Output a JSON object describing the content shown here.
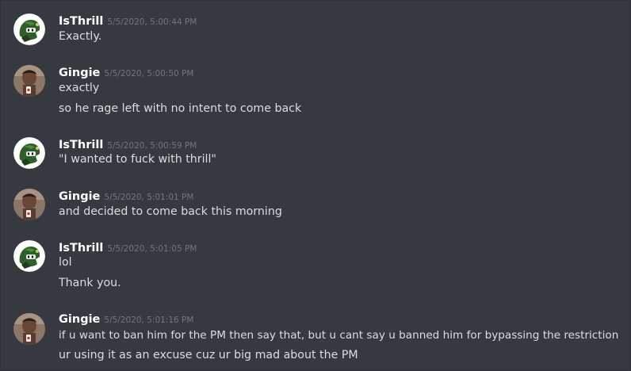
{
  "messages": [
    {
      "author": "IsThrill",
      "avatar_icon": "green-mask-icon",
      "timestamp": "5/5/2020, 5:00:44 PM",
      "lines": [
        "Exactly."
      ]
    },
    {
      "author": "Gingie",
      "avatar_icon": "photo-avatar-icon",
      "timestamp": "5/5/2020, 5:00:50 PM",
      "lines": [
        "exactly",
        "so he rage left with no intent to come back"
      ]
    },
    {
      "author": "IsThrill",
      "avatar_icon": "green-mask-icon",
      "timestamp": "5/5/2020, 5:00:59 PM",
      "lines": [
        "\"I wanted to fuck with thrill\""
      ]
    },
    {
      "author": "Gingie",
      "avatar_icon": "photo-avatar-icon",
      "timestamp": "5/5/2020, 5:01:01 PM",
      "lines": [
        "and decided to come back this morning"
      ]
    },
    {
      "author": "IsThrill",
      "avatar_icon": "green-mask-icon",
      "timestamp": "5/5/2020, 5:01:05 PM",
      "lines": [
        "lol",
        "Thank you."
      ]
    },
    {
      "author": "Gingie",
      "avatar_icon": "photo-avatar-icon",
      "timestamp": "5/5/2020, 5:01:16 PM",
      "lines": [
        "if u want to ban him for the PM then say that, but u cant say u banned him for bypassing the restriction",
        "ur using it as an excuse cuz ur big mad about the PM"
      ]
    }
  ],
  "colors": {
    "background": "#36393f",
    "username": "#ffffff",
    "timestamp": "#72767d",
    "message_text": "#dcddde"
  }
}
